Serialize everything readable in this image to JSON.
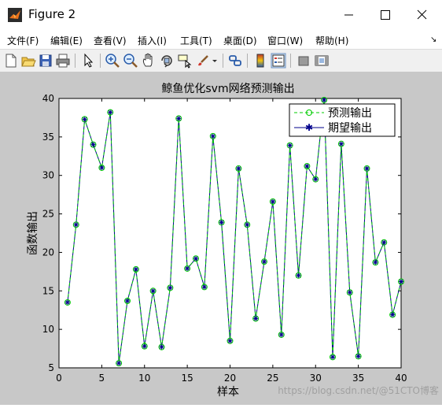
{
  "window": {
    "title": "Figure 2"
  },
  "menu": [
    "文件(F)",
    "编辑(E)",
    "查看(V)",
    "插入(I)",
    "工具(T)",
    "桌面(D)",
    "窗口(W)",
    "帮助(H)"
  ],
  "menu_arrow": "↘",
  "toolbar_icons": [
    "new-figure-icon",
    "open-file-icon",
    "save-icon",
    "print-icon",
    "edit-plot-arrow-icon",
    "zoom-in-icon",
    "zoom-out-icon",
    "pan-icon",
    "rotate-3d-icon",
    "data-cursor-icon",
    "brush-icon",
    "brush-dropdown-icon",
    "link-plot-icon",
    "colorbar-icon",
    "legend-icon",
    "hide-plot-tools-icon",
    "show-plot-tools-icon"
  ],
  "watermark": "https://blog.csdn.net/@51CTO博客",
  "chart_data": {
    "type": "line",
    "title": "鲸鱼优化svm网络预测输出",
    "xlabel": "样本",
    "ylabel": "函数输出",
    "xlim": [
      0,
      40
    ],
    "ylim": [
      5,
      40
    ],
    "xticks": [
      0,
      5,
      10,
      15,
      20,
      25,
      30,
      35,
      40
    ],
    "yticks": [
      5,
      10,
      15,
      20,
      25,
      30,
      35,
      40
    ],
    "grid": false,
    "legend_position": "top-right",
    "x": [
      1,
      2,
      3,
      4,
      5,
      6,
      7,
      8,
      9,
      10,
      11,
      12,
      13,
      14,
      15,
      16,
      17,
      18,
      19,
      20,
      21,
      22,
      23,
      24,
      25,
      26,
      27,
      28,
      29,
      30,
      31,
      32,
      33,
      34,
      35,
      36,
      37,
      38,
      39,
      40
    ],
    "series": [
      {
        "name": "预测输出",
        "color": "#00cc00",
        "style": "dashed-circle",
        "values": [
          13.5,
          23.6,
          37.3,
          34.0,
          31.0,
          38.2,
          5.6,
          13.7,
          17.8,
          7.8,
          15.0,
          7.7,
          15.4,
          37.4,
          17.9,
          19.2,
          15.5,
          35.1,
          23.9,
          8.5,
          30.9,
          23.6,
          11.4,
          18.8,
          26.6,
          9.3,
          33.9,
          17.0,
          31.2,
          29.5,
          39.8,
          6.4,
          34.1,
          14.8,
          6.5,
          30.9,
          18.7,
          21.3,
          11.9,
          16.2
        ]
      },
      {
        "name": "期望输出",
        "color": "#00008b",
        "style": "solid-star",
        "values": [
          13.5,
          23.6,
          37.3,
          34.0,
          31.0,
          38.2,
          5.6,
          13.7,
          17.8,
          7.8,
          15.0,
          7.7,
          15.4,
          37.4,
          17.9,
          19.2,
          15.5,
          35.1,
          23.9,
          8.5,
          30.9,
          23.6,
          11.4,
          18.8,
          26.6,
          9.3,
          33.9,
          17.0,
          31.2,
          29.5,
          39.8,
          6.4,
          34.1,
          14.8,
          6.5,
          30.9,
          18.7,
          21.3,
          11.9,
          16.2
        ]
      }
    ]
  }
}
